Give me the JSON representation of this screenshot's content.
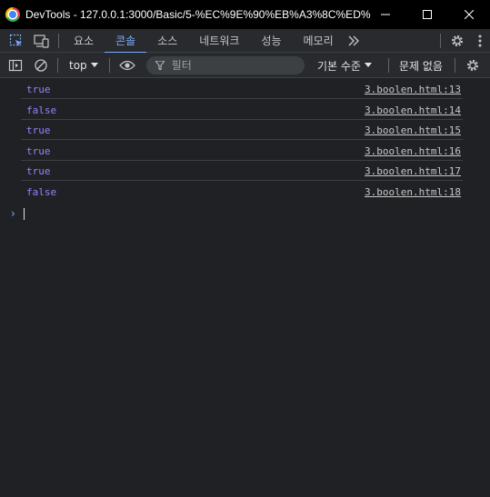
{
  "window": {
    "title": "DevTools - 127.0.0.1:3000/Basic/5-%EC%9E%90%EB%A3%8C%ED%...",
    "minimize_glyph": "—",
    "maximize_glyph": "☐",
    "close_glyph": "✕"
  },
  "tabs": [
    {
      "label": "요소",
      "active": false
    },
    {
      "label": "콘솔",
      "active": true
    },
    {
      "label": "소스",
      "active": false
    },
    {
      "label": "네트워크",
      "active": false
    },
    {
      "label": "성능",
      "active": false
    },
    {
      "label": "메모리",
      "active": false
    }
  ],
  "toolbar": {
    "context": "top",
    "filter_placeholder": "필터",
    "levels": "기본 수준",
    "issues": "문제 없음"
  },
  "console": {
    "messages": [
      {
        "value": "true",
        "source": "3.boolen.html:13"
      },
      {
        "value": "false",
        "source": "3.boolen.html:14"
      },
      {
        "value": "true",
        "source": "3.boolen.html:15"
      },
      {
        "value": "true",
        "source": "3.boolen.html:16"
      },
      {
        "value": "true",
        "source": "3.boolen.html:17"
      },
      {
        "value": "false",
        "source": "3.boolen.html:18"
      }
    ],
    "prompt_glyph": "›"
  },
  "colors": {
    "accent": "#7cacf8",
    "boolean": "#9980ff",
    "background": "#202124"
  }
}
